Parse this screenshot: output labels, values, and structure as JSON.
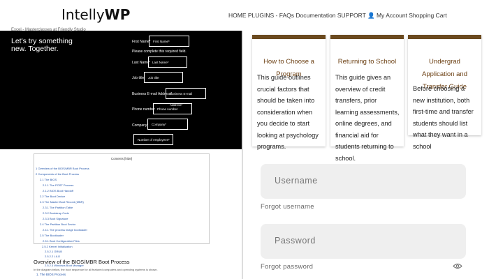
{
  "header": {
    "logo_light": "Intelly",
    "logo_bold": "WP",
    "nav": "HOME PLUGINS - FAQs Documentation SUPPORT 👤 My Account Shopping Cart"
  },
  "form": {
    "breadcrumb": "Excel - Masterclasses at Friendly Studio",
    "tagline": "Let's try something new. Together.",
    "required_msg": "Please complete this required field.",
    "fields": [
      {
        "label": "First Name*",
        "placeholder": "First Name*"
      },
      {
        "label": "Last Name*",
        "placeholder": "Last Name*"
      },
      {
        "label": "Job title",
        "placeholder": "Job title"
      },
      {
        "label": "Business E-mail Address*",
        "placeholder": "Business E-mail Address*"
      },
      {
        "label": "Phone number",
        "placeholder": "Phone number"
      },
      {
        "label": "Company*",
        "placeholder": "Company*"
      },
      {
        "label": "",
        "placeholder": "Number of employees*"
      }
    ]
  },
  "toc": {
    "title": "Contents [hide]",
    "items": [
      "1 Overview of the BIOS/MBR Boot Process",
      "2 Components of the Boot Process",
      "2.1 The BIOS",
      "2.1.1 The POST Process",
      "2.1.2 BIOS Boot Handoff",
      "2.2 The Boot Device",
      "2.3 The Master Boot Record (MBR)",
      "2.3.1 The Partition Table",
      "2.3.2 Bootstrap Code",
      "2.3.3 Boot Signature",
      "2.4 The Partition Boot Sector",
      "2.4.1 The process image bootloader",
      "2.5 The Bootloader",
      "2.5.1 Boot Configuration Files",
      "2.5.2 Kernel Initialization",
      "2.5.2.1 GRUB",
      "2.5.2.2 LILO",
      "2.5.2.3 Windows Boot Manager"
    ],
    "doc_title": "Overview of the BIOS/MBR Boot Process",
    "doc_line": "In the diagram below, the boot sequence for all featured computers and operating systems is shown.",
    "doc_link": "1. The BIOS Process"
  },
  "cards": [
    {
      "title": "How to Choose a Program",
      "body": "This guide outlines crucial factors that should be taken into consideration when you decide to start looking at psychology programs."
    },
    {
      "title": "Returning to School",
      "body": "This guide gives an overview of credit transfers, prior learning assessments, online degrees, and financial aid for students returning to school."
    },
    {
      "title": "Undergrad Application and Transfer Guide",
      "body": "Before choosing a new institution, both first-time and transfer students should list what they want in a school"
    }
  ],
  "login": {
    "username_placeholder": "Username",
    "forgot_username": "Forgot username",
    "password_placeholder": "Password",
    "forgot_password": "Forgot password"
  }
}
